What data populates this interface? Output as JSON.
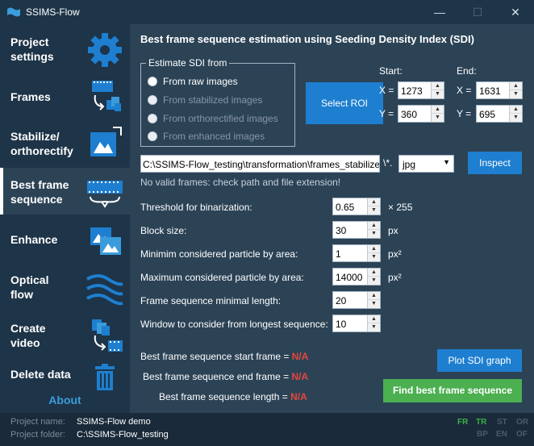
{
  "window": {
    "title": "SSIMS-Flow",
    "min_glyph": "—",
    "max_glyph": "☐",
    "close_glyph": "✕"
  },
  "sidebar": {
    "items": [
      {
        "label": "Project\nsettings",
        "icon": "gear-icon",
        "active": false
      },
      {
        "label": "Frames",
        "icon": "film-frames-icon",
        "active": false
      },
      {
        "label": "Stabilize/\northorectify",
        "icon": "image-transform-icon",
        "active": false
      },
      {
        "label": "Best frame\nsequence",
        "icon": "filmstrip-icon",
        "active": true
      },
      {
        "label": "Enhance",
        "icon": "enhance-image-icon",
        "active": false
      },
      {
        "label": "Optical\nflow",
        "icon": "flow-waves-icon",
        "active": false
      },
      {
        "label": "Create\nvideo",
        "icon": "video-stack-icon",
        "active": false
      },
      {
        "label": "Delete data",
        "icon": "trash-icon",
        "active": false
      }
    ],
    "about": "About"
  },
  "main": {
    "title": "Best frame sequence estimation using Seeding Density Index (SDI)",
    "estimate_group": {
      "legend": "Estimate SDI from",
      "options": [
        {
          "label": "From raw images",
          "enabled": true
        },
        {
          "label": "From stabilized images",
          "enabled": false
        },
        {
          "label": "From orthorectified images",
          "enabled": false
        },
        {
          "label": "From enhanced images",
          "enabled": false
        }
      ]
    },
    "select_roi": "Select ROI",
    "roi": {
      "start_label": "Start:",
      "end_label": "End:",
      "x_label": "X =",
      "y_label": "Y =",
      "start_x": "1273",
      "start_y": "360",
      "end_x": "1631",
      "end_y": "695"
    },
    "path": "C:\\SSIMS-Flow_testing\\transformation\\frames_stabilized",
    "path_sep": "\\*.",
    "extension": "jpg",
    "inspect": "Inspect",
    "path_status": "No valid frames: check path and file extension!",
    "params": [
      {
        "label": "Threshold for binarization:",
        "value": "0.65",
        "unit": "× 255"
      },
      {
        "label": "Block size:",
        "value": "30",
        "unit": "px"
      },
      {
        "label": "Minimim considered particle by area:",
        "value": "1",
        "unit": "px²"
      },
      {
        "label": "Maximum considered particle by area:",
        "value": "14000",
        "unit": "px²"
      },
      {
        "label": "Frame sequence minimal length:",
        "value": "20",
        "unit": ""
      },
      {
        "label": "Window to consider from longest sequence:",
        "value": "10",
        "unit": ""
      }
    ],
    "results": {
      "start_label": "Best frame sequence start frame =",
      "end_label": "Best frame sequence end frame =",
      "length_label": "Best frame sequence length =",
      "start_value": "N/A",
      "end_value": "N/A",
      "length_value": "N/A"
    },
    "plot_sdi": "Plot SDI graph",
    "find_best": "Find best frame sequence"
  },
  "footer": {
    "project_name_label": "Project name:",
    "project_name": "SSIMS-Flow demo",
    "project_folder_label": "Project folder:",
    "project_folder": "C:\\SSIMS-Flow_testing",
    "stages_row1": [
      {
        "code": "FR",
        "done": true
      },
      {
        "code": "TR",
        "done": true
      },
      {
        "code": "ST",
        "done": false
      },
      {
        "code": "OR",
        "done": false
      }
    ],
    "stages_row2": [
      {
        "code": "BP",
        "done": false
      },
      {
        "code": "EN",
        "done": false
      },
      {
        "code": "OF",
        "done": false
      }
    ]
  },
  "colors": {
    "accent": "#1e7fd0",
    "success": "#4caf50",
    "error_value": "#e8453c",
    "stage_done": "#3cb043"
  }
}
